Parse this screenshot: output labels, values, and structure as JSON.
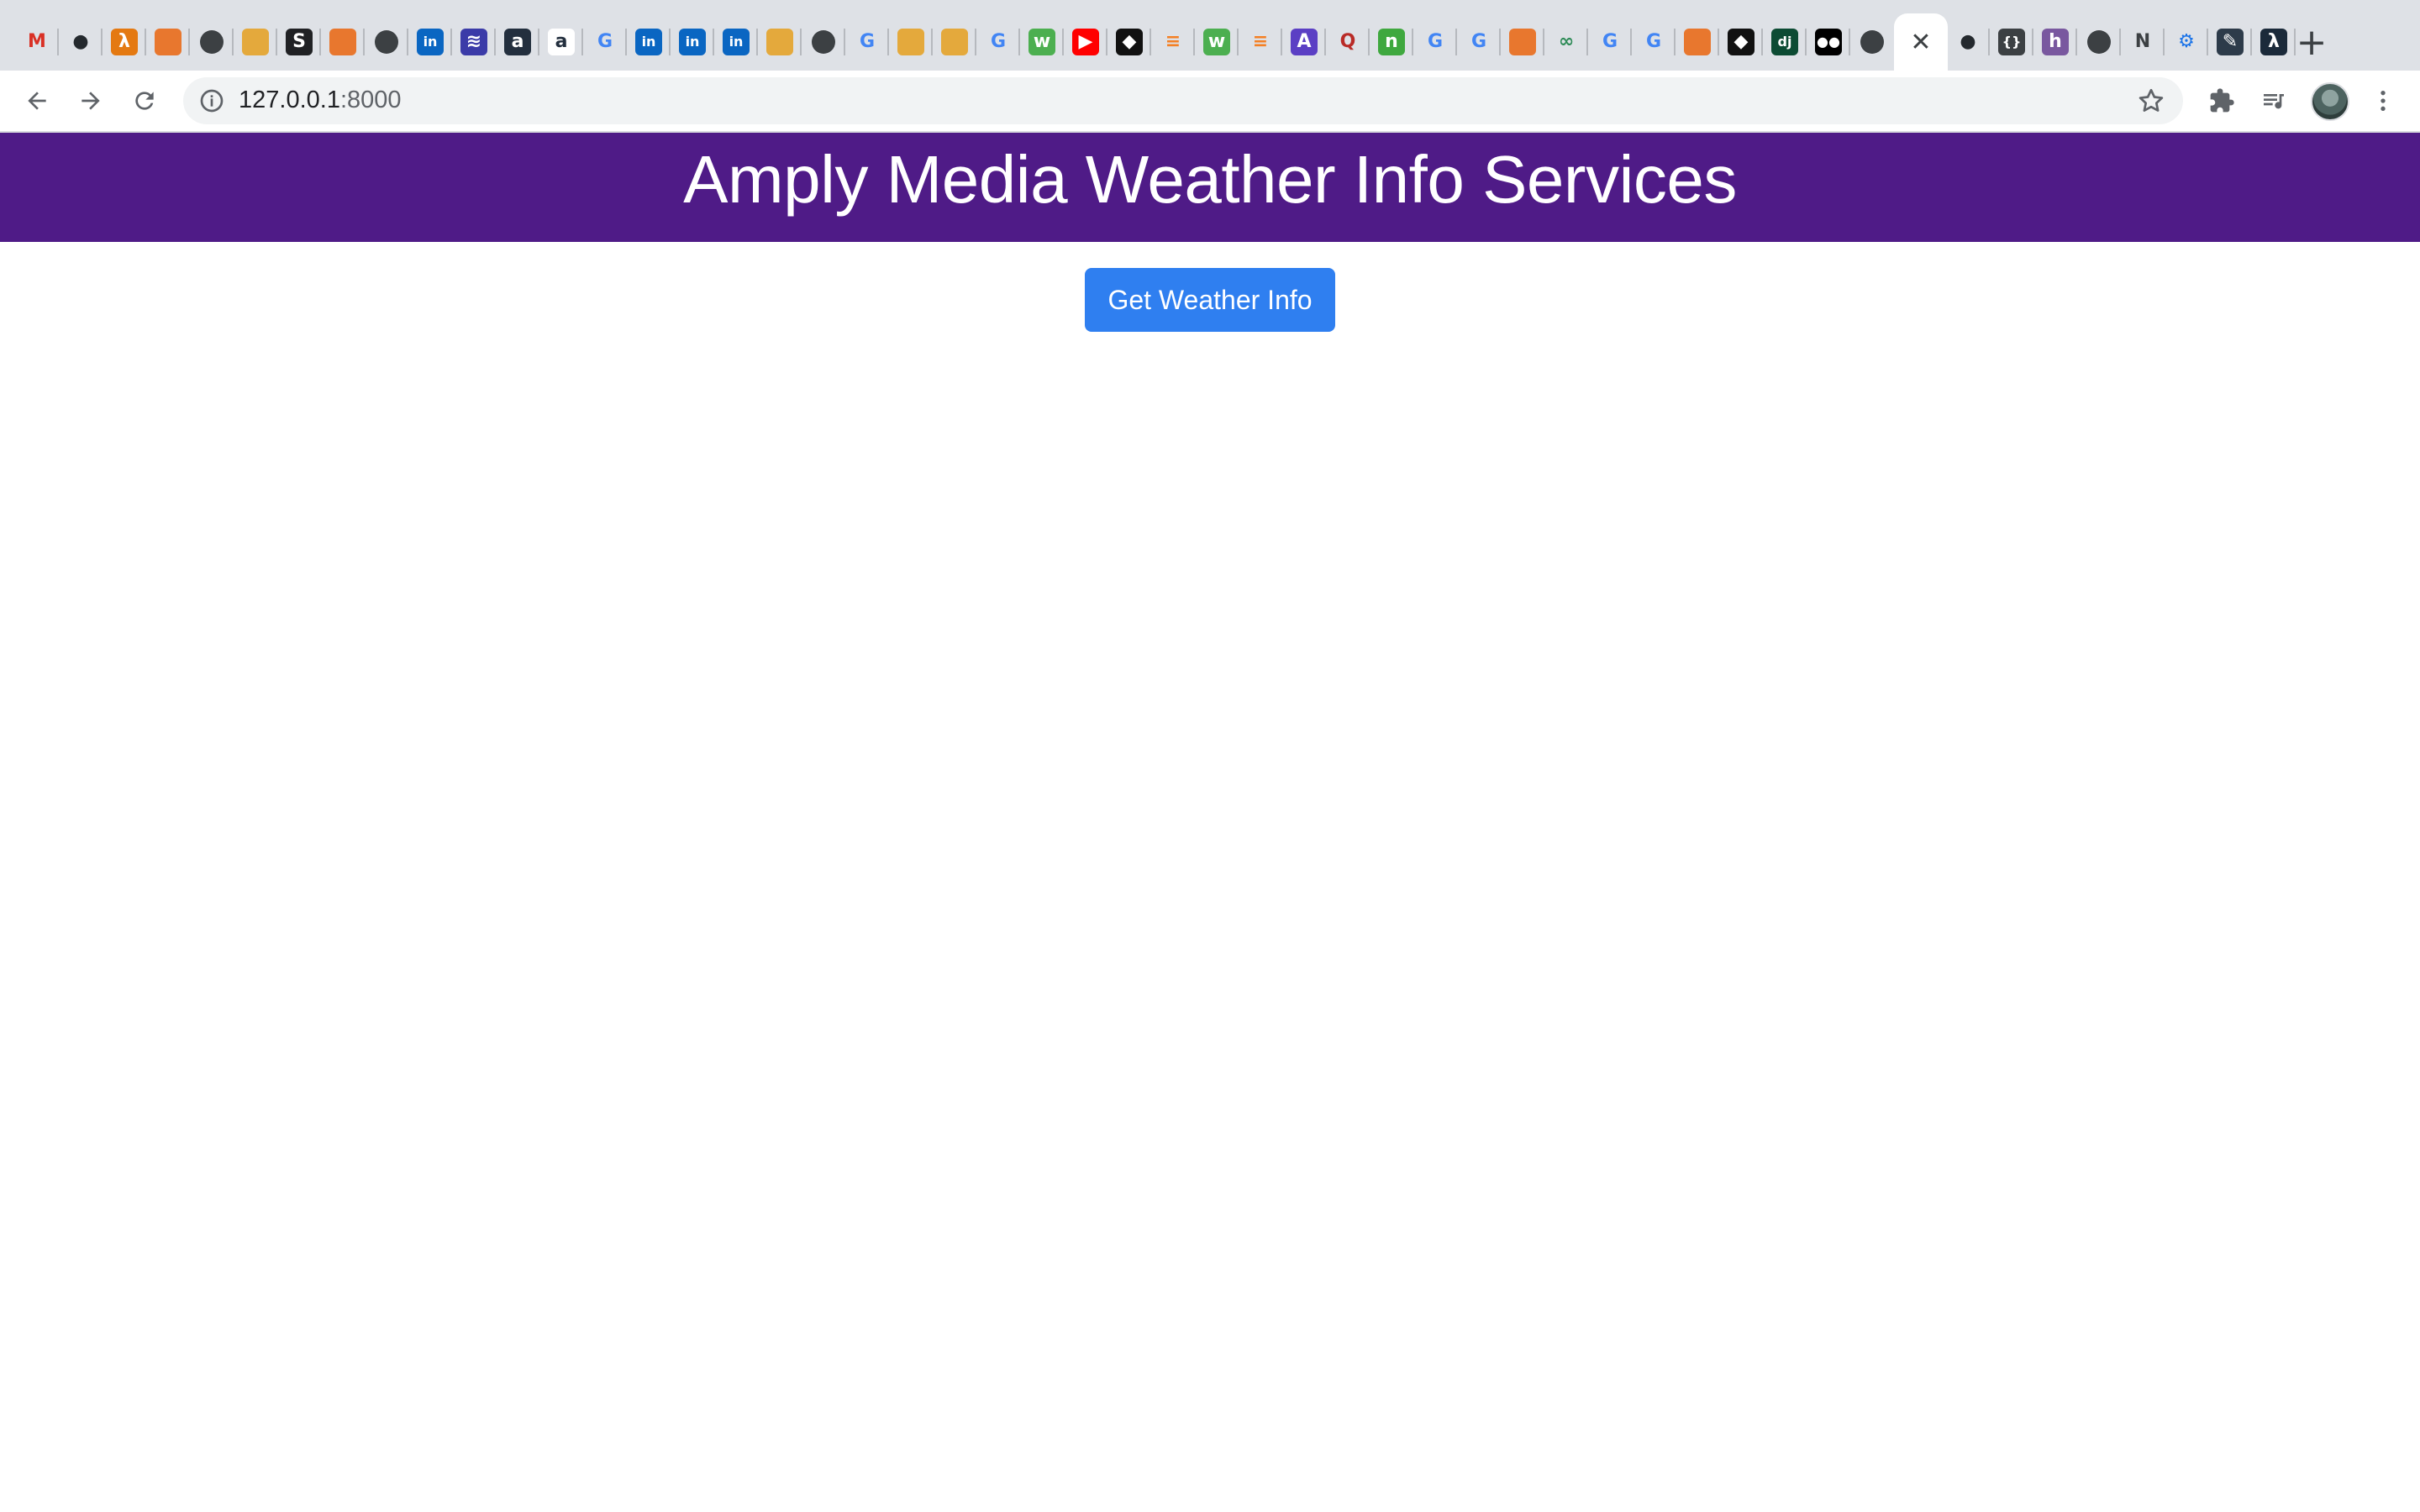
{
  "browser": {
    "tabs": [
      {
        "icon": "gmail-icon",
        "glyph": "M",
        "color": "#d93025",
        "bg": "transparent"
      },
      {
        "icon": "github-icon",
        "glyph": "●",
        "color": "#24292e",
        "bg": "transparent"
      },
      {
        "icon": "lambda-icon",
        "glyph": "λ",
        "color": "#ffffff",
        "bg": "#e47911"
      },
      {
        "icon": "package-cube-icon",
        "glyph": "",
        "color": "#ffffff",
        "bg": "#e8772e"
      },
      {
        "icon": "globe-icon",
        "glyph": "",
        "color": "#ffffff",
        "bg": "#3c4043"
      },
      {
        "icon": "book-icon",
        "glyph": "",
        "color": "#ffffff",
        "bg": "#e4a93c"
      },
      {
        "icon": "sa-icon",
        "glyph": "S",
        "color": "#ffffff",
        "bg": "#202124"
      },
      {
        "icon": "package-cube-icon",
        "glyph": "",
        "color": "#ffffff",
        "bg": "#e8772e"
      },
      {
        "icon": "globe-icon",
        "glyph": "",
        "color": "#ffffff",
        "bg": "#3c4043"
      },
      {
        "icon": "linkedin-icon",
        "glyph": "in",
        "color": "#ffffff",
        "bg": "#0a66c2"
      },
      {
        "icon": "wave-icon",
        "glyph": "≋",
        "color": "#ffffff",
        "bg": "#3b3ba8"
      },
      {
        "icon": "a-letter-icon",
        "glyph": "a",
        "color": "#ffffff",
        "bg": "#232f3e"
      },
      {
        "icon": "amazon-icon",
        "glyph": "a",
        "color": "#232f3e",
        "bg": "#ffffff"
      },
      {
        "icon": "google-icon",
        "glyph": "G",
        "color": "#4285f4",
        "bg": "transparent"
      },
      {
        "icon": "linkedin-icon",
        "glyph": "in",
        "color": "#ffffff",
        "bg": "#0a66c2"
      },
      {
        "icon": "linkedin-icon",
        "glyph": "in",
        "color": "#ffffff",
        "bg": "#0a66c2"
      },
      {
        "icon": "linkedin-icon",
        "glyph": "in",
        "color": "#ffffff",
        "bg": "#0a66c2"
      },
      {
        "icon": "book-icon",
        "glyph": "",
        "color": "#ffffff",
        "bg": "#e4a93c"
      },
      {
        "icon": "globe-icon",
        "glyph": "",
        "color": "#ffffff",
        "bg": "#3c4043"
      },
      {
        "icon": "google-icon",
        "glyph": "G",
        "color": "#4285f4",
        "bg": "transparent"
      },
      {
        "icon": "book-icon",
        "glyph": "",
        "color": "#ffffff",
        "bg": "#e4a93c"
      },
      {
        "icon": "book-icon",
        "glyph": "",
        "color": "#ffffff",
        "bg": "#e4a93c"
      },
      {
        "icon": "google-icon",
        "glyph": "G",
        "color": "#4285f4",
        "bg": "transparent"
      },
      {
        "icon": "w3schools-icon",
        "glyph": "w",
        "color": "#ffffff",
        "bg": "#4caf50"
      },
      {
        "icon": "youtube-icon",
        "glyph": "▶",
        "color": "#ffffff",
        "bg": "#ff0000"
      },
      {
        "icon": "chat-bubble-icon",
        "glyph": "◆",
        "color": "#ffffff",
        "bg": "#111111"
      },
      {
        "icon": "stackoverflow-icon",
        "glyph": "≡",
        "color": "#f48024",
        "bg": "transparent"
      },
      {
        "icon": "w3schools-icon",
        "glyph": "w",
        "color": "#ffffff",
        "bg": "#4caf50"
      },
      {
        "icon": "stackoverflow-icon",
        "glyph": "≡",
        "color": "#f48024",
        "bg": "transparent"
      },
      {
        "icon": "rocket-icon",
        "glyph": "A",
        "color": "#ffffff",
        "bg": "#5b3fc4"
      },
      {
        "icon": "quora-icon",
        "glyph": "Q",
        "color": "#b92b27",
        "bg": "transparent"
      },
      {
        "icon": "node-icon",
        "glyph": "n",
        "color": "#ffffff",
        "bg": "#3fa83f"
      },
      {
        "icon": "google-icon",
        "glyph": "G",
        "color": "#4285f4",
        "bg": "transparent"
      },
      {
        "icon": "google-icon",
        "glyph": "G",
        "color": "#4285f4",
        "bg": "transparent"
      },
      {
        "icon": "package-cube-icon",
        "glyph": "",
        "color": "#ffffff",
        "bg": "#e8772e"
      },
      {
        "icon": "glasses-icon",
        "glyph": "∞",
        "color": "#2e8b57",
        "bg": "transparent"
      },
      {
        "icon": "google-icon",
        "glyph": "G",
        "color": "#4285f4",
        "bg": "transparent"
      },
      {
        "icon": "google-icon",
        "glyph": "G",
        "color": "#4285f4",
        "bg": "transparent"
      },
      {
        "icon": "package-cube-icon",
        "glyph": "",
        "color": "#ffffff",
        "bg": "#e8772e"
      },
      {
        "icon": "chat-bubble-icon",
        "glyph": "◆",
        "color": "#ffffff",
        "bg": "#111111"
      },
      {
        "icon": "django-icon",
        "glyph": "dj",
        "color": "#ffffff",
        "bg": "#0c4b33"
      },
      {
        "icon": "medium-icon",
        "glyph": "●●",
        "color": "#ffffff",
        "bg": "#000000"
      },
      {
        "icon": "globe-icon",
        "glyph": "",
        "color": "#ffffff",
        "bg": "#3c4043"
      },
      {
        "icon": "close-icon",
        "glyph": "✕",
        "color": "#3c4043",
        "bg": "transparent",
        "active": true
      },
      {
        "icon": "github-icon",
        "glyph": "●",
        "color": "#24292e",
        "bg": "transparent"
      },
      {
        "icon": "braces-icon",
        "glyph": "{}",
        "color": "#ffffff",
        "bg": "#3c4043"
      },
      {
        "icon": "heroku-icon",
        "glyph": "h",
        "color": "#ffffff",
        "bg": "#79589f"
      },
      {
        "icon": "globe-icon",
        "glyph": "",
        "color": "#ffffff",
        "bg": "#3c4043"
      },
      {
        "icon": "notion-icon",
        "glyph": "N",
        "color": "#3c4043",
        "bg": "transparent"
      },
      {
        "icon": "gear-icon",
        "glyph": "⚙",
        "color": "#1a73e8",
        "bg": "transparent"
      },
      {
        "icon": "pencil-icon",
        "glyph": "✎",
        "color": "#ffffff",
        "bg": "#2d3b4a"
      },
      {
        "icon": "lambda-icon",
        "glyph": "λ",
        "color": "#ffffff",
        "bg": "#1b2a3a"
      }
    ]
  },
  "address_bar": {
    "host": "127.0.0.1",
    "port": ":8000"
  },
  "page": {
    "title": "Amply Media Weather Info Services",
    "button_label": "Get Weather Info",
    "banner_color": "#4f1b87",
    "button_color": "#2f7ff0"
  }
}
